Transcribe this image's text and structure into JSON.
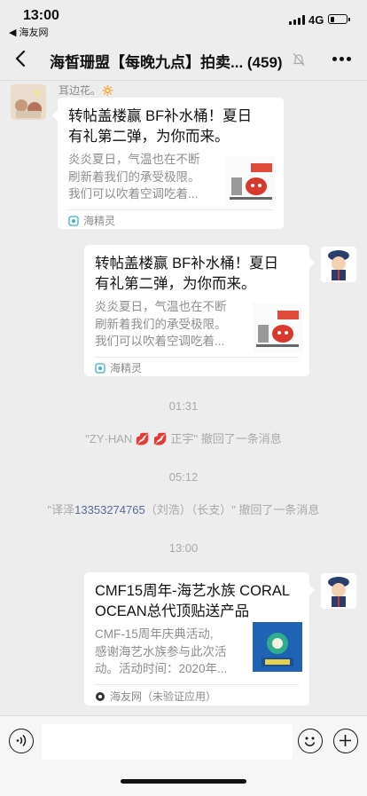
{
  "status_bar": {
    "time": "13:00",
    "back_app": "◀ 海友网",
    "network": "4G",
    "battery_level": 0.3
  },
  "nav": {
    "title": "海皙珊盟【每晚九点】拍卖... (459)"
  },
  "messages": [
    {
      "sender": "耳边花。🔅",
      "side": "left",
      "card": {
        "title_lines": [
          "转帖盖楼赢 BF补水桶！夏日",
          "有礼第二弹，为你而来。"
        ],
        "desc_lines": [
          "炎炎夏日，气温也在不断",
          "刷新着我们的承受极限。",
          "我们可以吹着空调吃着..."
        ],
        "source": "海精灵"
      }
    },
    {
      "side": "right",
      "card": {
        "title_lines": [
          "转帖盖楼赢 BF补水桶！夏日",
          "有礼第二弹，为你而来。"
        ],
        "desc_lines": [
          "炎炎夏日，气温也在不断",
          "刷新着我们的承受极限。",
          "我们可以吹着空调吃着..."
        ],
        "source": "海精灵"
      }
    },
    {
      "side": "right",
      "card": {
        "title_lines": [
          "CMF15周年-海艺水族 CORAL",
          "OCEAN总代顶贴送产品"
        ],
        "desc_lines": [
          "CMF-15周年庆典活动,",
          "感谢海艺水族参与此次活",
          "动。活动时间：2020年..."
        ],
        "source": "海友网（未验证应用）"
      }
    }
  ],
  "timestamps": [
    "01:31",
    "05:12",
    "13:00"
  ],
  "system_messages": [
    {
      "text": "\"ZY·HAN 💋 💋 正宇\" 撤回了一条消息"
    },
    {
      "prefix": "\"译泽",
      "phone": "13353274765",
      "suffix": "（刘浩）（长支）\" 撤回了一条消息"
    }
  ],
  "colors": {
    "background": "#ededed",
    "card": "#ffffff",
    "link_blue": "#576b95",
    "muted_text": "#a9a9a9"
  }
}
